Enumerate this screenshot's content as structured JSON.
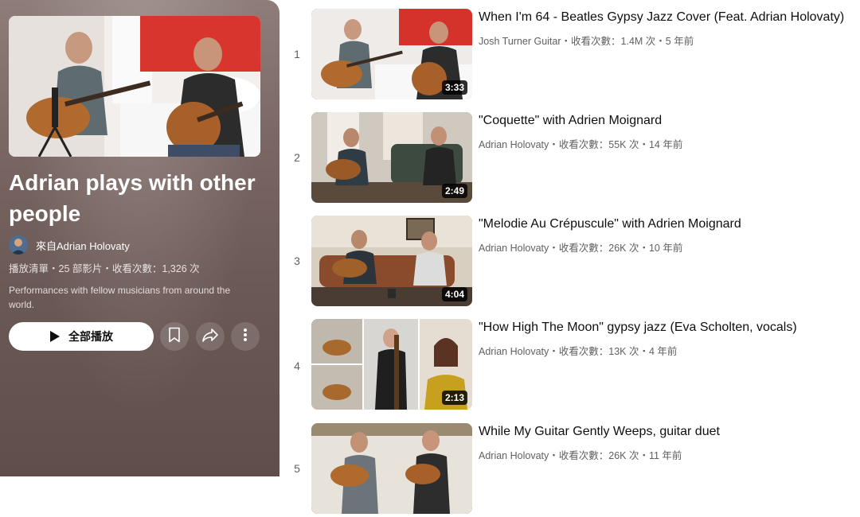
{
  "playlist": {
    "title": "Adrian plays with other people",
    "owner": "來自Adrian Holovaty",
    "meta": "播放清單・25 部影片・收看次數：1,326 次",
    "description": "Performances with fellow musicians from around the world.",
    "play_all_label": "全部播放",
    "icons": [
      "play-icon",
      "save-icon",
      "share-icon",
      "more-icon"
    ]
  },
  "videos": [
    {
      "index": "1",
      "title": "When I'm 64 - Beatles Gypsy Jazz Cover (Feat. Adrian Holovaty)",
      "meta": "Josh Turner Guitar・收看次數：1.4M 次・5 年前",
      "duration": "3:33"
    },
    {
      "index": "2",
      "title": "\"Coquette\" with Adrien Moignard",
      "meta": "Adrian Holovaty・收看次數：55K 次・14 年前",
      "duration": "2:49"
    },
    {
      "index": "3",
      "title": "\"Melodie Au Crépuscule\" with Adrien Moignard",
      "meta": "Adrian Holovaty・收看次數：26K 次・10 年前",
      "duration": "4:04"
    },
    {
      "index": "4",
      "title": "\"How High The Moon\" gypsy jazz (Eva Scholten, vocals)",
      "meta": "Adrian Holovaty・收看次數：13K 次・4 年前",
      "duration": "2:13"
    },
    {
      "index": "5",
      "title": "While My Guitar Gently Weeps, guitar duet",
      "meta": "Adrian Holovaty・收看次數：26K 次・11 年前",
      "duration": ""
    }
  ]
}
